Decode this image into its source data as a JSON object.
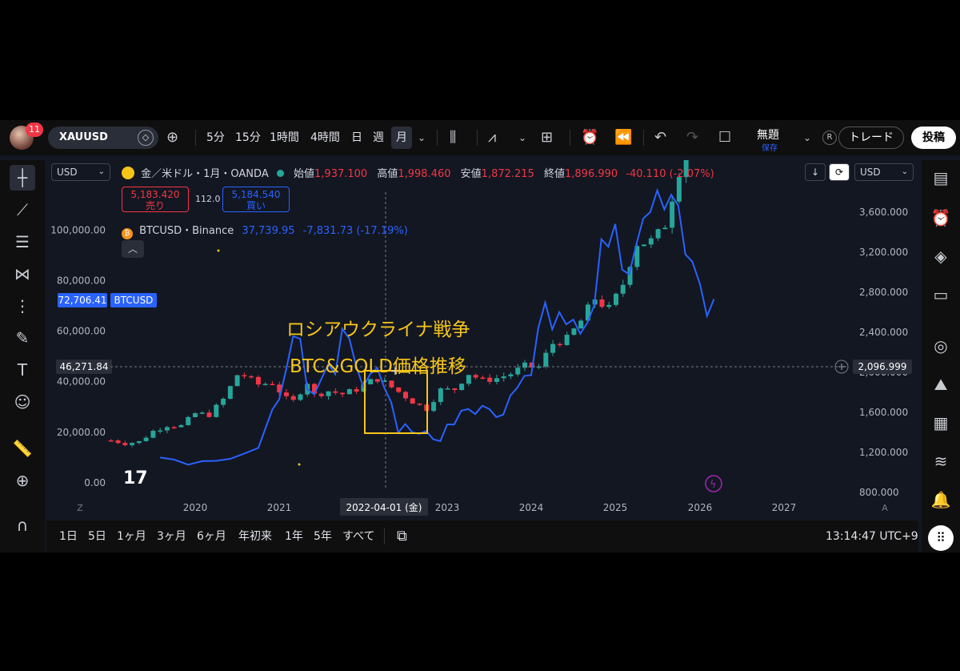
{
  "topbar": {
    "notification_count": "11",
    "symbol": "XAUUSD",
    "intervals": [
      "5分",
      "15分",
      "1時間",
      "4時間",
      "日",
      "週",
      "月"
    ],
    "selected_interval": "月",
    "layout_name": "無題",
    "save_label": "保存",
    "r_label": "R",
    "trade_label": "トレード",
    "post_label": "投稿"
  },
  "legend": {
    "title": "金／米ドル・1月・OANDA",
    "open_label": "始値",
    "open": "1,937.100",
    "high_label": "高値",
    "high": "1,998.460",
    "low_label": "安値",
    "low": "1,872.215",
    "close_label": "終値",
    "close": "1,896.990",
    "change": "-40.110 (-2.07%)",
    "sell_price": "5,183.420",
    "sell_label": "売り",
    "spread": "112.0",
    "buy_price": "5,184.540",
    "buy_label": "買い",
    "compare_label": "BTCUSD・Binance",
    "compare_value": "37,739.95",
    "compare_change": "-7,831.73 (-17.19%)",
    "collapse_icon": "chevron-up-icon"
  },
  "currency_left": "USD",
  "currency_right": "USD",
  "overlay": {
    "line1": "ロシアウクライナ戦争",
    "line2": "BTC&GOLD価格推移"
  },
  "colors": {
    "up": "#26a69a",
    "down": "#f23645",
    "btc_line": "#2962ff",
    "annotation": "#f5c518",
    "background": "#131722"
  },
  "chart_data": {
    "type": "line",
    "x_ticks": [
      "2020",
      "2021",
      "2023",
      "2024",
      "2025",
      "2026",
      "2027"
    ],
    "crosshair_date": "2022-04-01 (金)",
    "left_axis_ticks": [
      "100,000.00",
      "80,000.00",
      "60,000.00",
      "40,000.00",
      "20,000.00",
      "0.00"
    ],
    "right_axis_ticks": [
      "3,600.000",
      "3,200.000",
      "2,800.000",
      "2,400.000",
      "2,000.000",
      "1,600.000",
      "1,200.000",
      "800.000"
    ],
    "left_label_btc": {
      "value": "72,706.41",
      "name": "BTCUSD"
    },
    "left_label_crosshair": "46,271.84",
    "right_label_crosshair": "2,096.999",
    "corner_left": "Z",
    "corner_right": "A",
    "series": [
      {
        "name": "BTCUSD",
        "axis": "left",
        "points": [
          [
            "2019-08",
            10000
          ],
          [
            "2019-10",
            9200
          ],
          [
            "2019-12",
            7200
          ],
          [
            "2020-02",
            8600
          ],
          [
            "2020-04",
            8700
          ],
          [
            "2020-06",
            9500
          ],
          [
            "2020-08",
            11600
          ],
          [
            "2020-10",
            13800
          ],
          [
            "2020-12",
            29000
          ],
          [
            "2021-01",
            33000
          ],
          [
            "2021-02",
            45000
          ],
          [
            "2021-03",
            58000
          ],
          [
            "2021-04",
            57000
          ],
          [
            "2021-05",
            37000
          ],
          [
            "2021-06",
            35000
          ],
          [
            "2021-07",
            41000
          ],
          [
            "2021-08",
            47000
          ],
          [
            "2021-09",
            43000
          ],
          [
            "2021-10",
            61000
          ],
          [
            "2021-11",
            57000
          ],
          [
            "2021-12",
            46000
          ],
          [
            "2022-01",
            38000
          ],
          [
            "2022-02",
            43000
          ],
          [
            "2022-03",
            45500
          ],
          [
            "2022-04",
            37700
          ],
          [
            "2022-05",
            31800
          ],
          [
            "2022-06",
            19900
          ],
          [
            "2022-07",
            23300
          ],
          [
            "2022-08",
            20000
          ],
          [
            "2022-09",
            19400
          ],
          [
            "2022-10",
            20500
          ],
          [
            "2022-11",
            17200
          ],
          [
            "2022-12",
            16500
          ],
          [
            "2023-01",
            23100
          ],
          [
            "2023-02",
            23100
          ],
          [
            "2023-03",
            28500
          ],
          [
            "2023-04",
            29200
          ],
          [
            "2023-05",
            27200
          ],
          [
            "2023-06",
            30500
          ],
          [
            "2023-07",
            29200
          ],
          [
            "2023-08",
            26000
          ],
          [
            "2023-09",
            27000
          ],
          [
            "2023-10",
            34500
          ],
          [
            "2023-11",
            37700
          ],
          [
            "2023-12",
            42300
          ],
          [
            "2024-01",
            42600
          ],
          [
            "2024-02",
            61200
          ],
          [
            "2024-03",
            71300
          ],
          [
            "2024-04",
            60700
          ],
          [
            "2024-05",
            67500
          ],
          [
            "2024-06",
            62700
          ],
          [
            "2024-07",
            64600
          ],
          [
            "2024-08",
            59000
          ],
          [
            "2024-09",
            63300
          ],
          [
            "2024-10",
            70300
          ],
          [
            "2024-11",
            96400
          ],
          [
            "2024-12",
            93400
          ],
          [
            "2025-01",
            102400
          ],
          [
            "2025-02",
            84300
          ],
          [
            "2025-03",
            82500
          ],
          [
            "2025-04",
            94200
          ],
          [
            "2025-05",
            104600
          ],
          [
            "2025-06",
            107100
          ],
          [
            "2025-07",
            115700
          ],
          [
            "2025-08",
            108200
          ],
          [
            "2025-09",
            114000
          ],
          [
            "2025-10",
            109600
          ],
          [
            "2025-11",
            90400
          ],
          [
            "2025-12",
            87500
          ],
          [
            "2026-01",
            78600
          ],
          [
            "2026-02",
            66000
          ],
          [
            "2026-03",
            72706
          ]
        ]
      },
      {
        "name": "XAUUSD",
        "axis": "right",
        "candles_close": [
          [
            "2019-01",
            1320
          ],
          [
            "2019-03",
            1292
          ],
          [
            "2019-05",
            1305
          ],
          [
            "2019-07",
            1413
          ],
          [
            "2019-09",
            1472
          ],
          [
            "2019-11",
            1464
          ],
          [
            "2020-01",
            1589
          ],
          [
            "2020-03",
            1577
          ],
          [
            "2020-05",
            1730
          ],
          [
            "2020-07",
            1975
          ],
          [
            "2020-08",
            1967
          ],
          [
            "2020-10",
            1879
          ],
          [
            "2020-12",
            1895
          ],
          [
            "2021-02",
            1734
          ],
          [
            "2021-03",
            1708
          ],
          [
            "2021-05",
            1906
          ],
          [
            "2021-06",
            1771
          ],
          [
            "2021-08",
            1814
          ],
          [
            "2021-10",
            1783
          ],
          [
            "2021-12",
            1829
          ],
          [
            "2022-02",
            1909
          ],
          [
            "2022-03",
            1937
          ],
          [
            "2022-04",
            1897
          ],
          [
            "2022-06",
            1807
          ],
          [
            "2022-08",
            1711
          ],
          [
            "2022-10",
            1633
          ],
          [
            "2022-12",
            1824
          ],
          [
            "2023-02",
            1827
          ],
          [
            "2023-04",
            1990
          ],
          [
            "2023-06",
            1919
          ],
          [
            "2023-08",
            1940
          ],
          [
            "2023-10",
            1983
          ],
          [
            "2023-12",
            2063
          ],
          [
            "2024-02",
            2044
          ],
          [
            "2024-04",
            2286
          ],
          [
            "2024-06",
            2327
          ],
          [
            "2024-08",
            2503
          ],
          [
            "2024-10",
            2744
          ],
          [
            "2024-12",
            2625
          ],
          [
            "2025-02",
            2858
          ],
          [
            "2025-04",
            3289
          ],
          [
            "2025-06",
            3303
          ],
          [
            "2025-08",
            3447
          ],
          [
            "2025-10",
            4000
          ],
          [
            "2025-12",
            4300
          ]
        ]
      }
    ],
    "left_ylim": [
      0,
      115000
    ],
    "right_ylim": [
      800,
      4000
    ]
  },
  "bottombar": {
    "ranges": [
      "1日",
      "5日",
      "1ヶ月",
      "3ヶ月",
      "6ヶ月",
      "年初来",
      "1年",
      "5年",
      "すべて"
    ],
    "time": "13:14:47 UTC+9"
  }
}
